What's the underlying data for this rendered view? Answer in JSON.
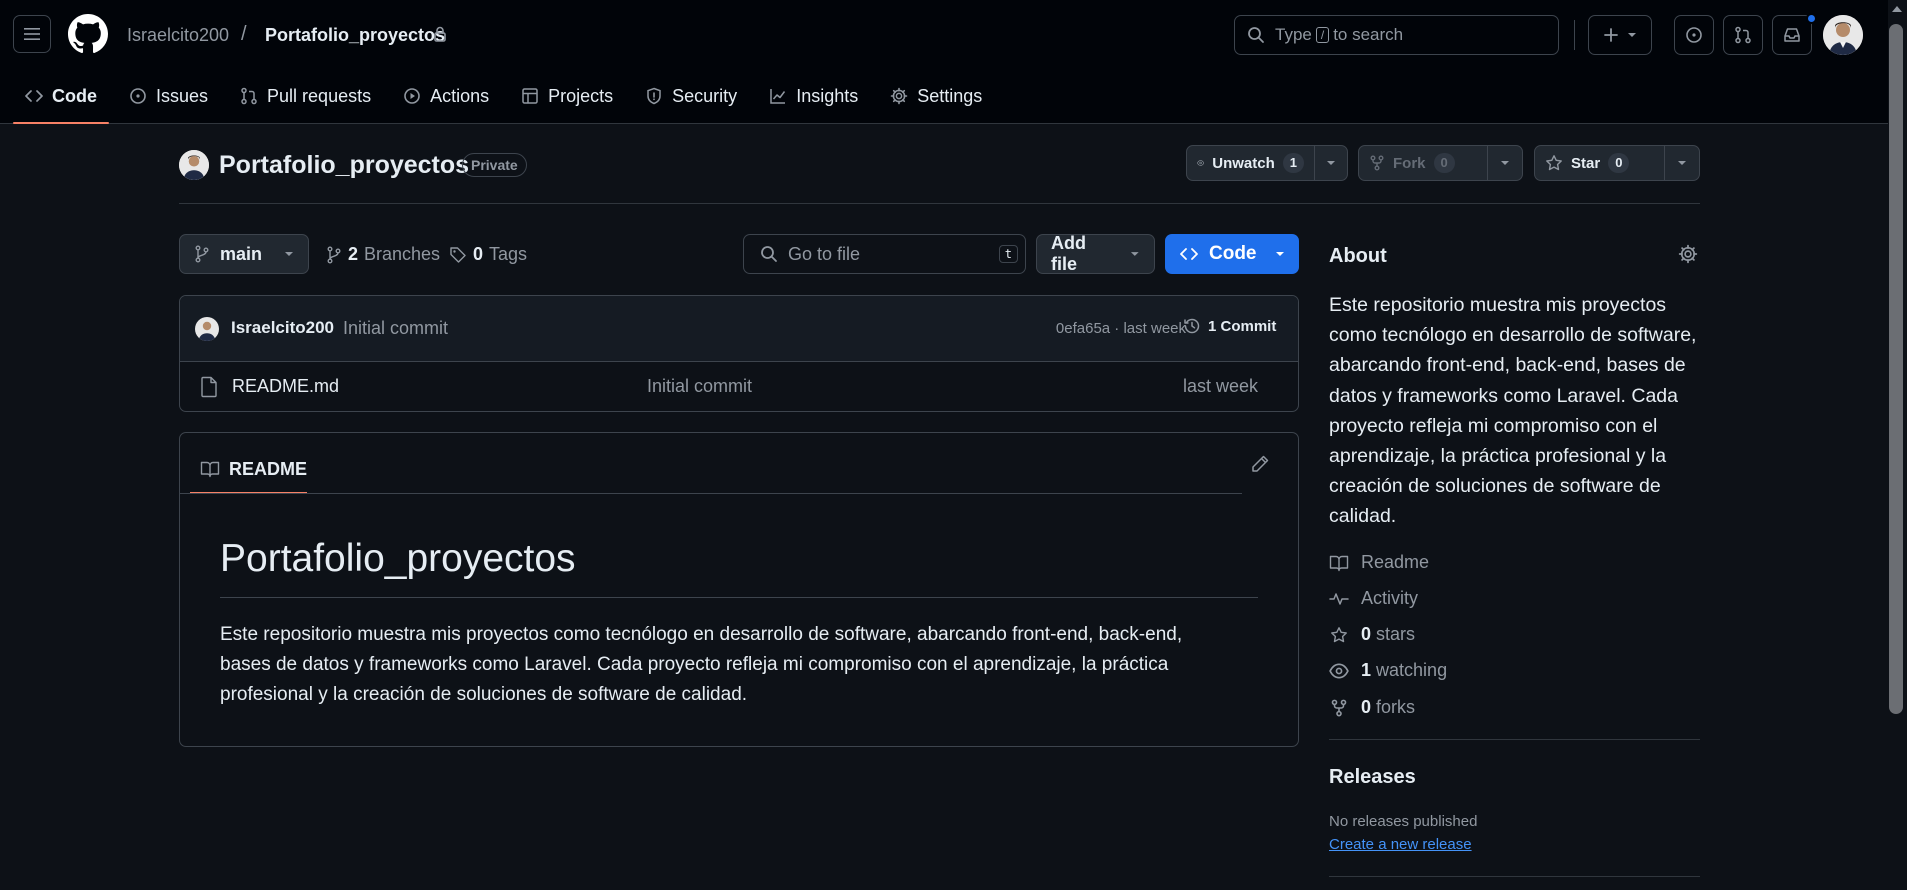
{
  "header": {
    "owner": "Israelcito200",
    "separator": "/",
    "repo_name": "Portafolio_proyectos",
    "search_prefix": "Type",
    "search_key": "/",
    "search_suffix": "to search"
  },
  "nav": {
    "code": "Code",
    "issues": "Issues",
    "pull_requests": "Pull requests",
    "actions": "Actions",
    "projects": "Projects",
    "security": "Security",
    "insights": "Insights",
    "settings": "Settings"
  },
  "repo": {
    "title": "Portafolio_proyectos",
    "visibility": "Private",
    "unwatch_label": "Unwatch",
    "watch_count": "1",
    "fork_label": "Fork",
    "fork_count": "0",
    "star_label": "Star",
    "star_count": "0"
  },
  "toolbar": {
    "branch": "main",
    "branches_count": "2",
    "branches_label": "Branches",
    "tags_count": "0",
    "tags_label": "Tags",
    "goto_placeholder": "Go to file",
    "goto_key": "t",
    "add_file": "Add file",
    "code_button": "Code"
  },
  "commit": {
    "author": "Israelcito200",
    "message": "Initial commit",
    "sha_time": "0efa65a · last week",
    "count_label": "1 Commit"
  },
  "files": [
    {
      "name": "README.md",
      "message": "Initial commit",
      "time": "last week"
    }
  ],
  "readme": {
    "tab_label": "README",
    "heading": "Portafolio_proyectos",
    "body": "Este repositorio muestra mis proyectos como tecnólogo en desarrollo de software, abarcando front-end, back-end, bases de datos y frameworks como Laravel. Cada proyecto refleja mi compromiso con el aprendizaje, la práctica profesional y la creación de soluciones de software de calidad."
  },
  "about": {
    "heading": "About",
    "description": "Este repositorio muestra mis proyectos como tecnólogo en desarrollo de software, abarcando front-end, back-end, bases de datos y frameworks como Laravel. Cada proyecto refleja mi compromiso con el aprendizaje, la práctica profesional y la creación de soluciones de software de calidad.",
    "readme_link": "Readme",
    "activity_link": "Activity",
    "stars_count": "0",
    "stars_label": "stars",
    "watching_count": "1",
    "watching_label": "watching",
    "forks_count": "0",
    "forks_label": "forks"
  },
  "releases": {
    "heading": "Releases",
    "none_text": "No releases published",
    "create_link": "Create a new release"
  },
  "colors": {
    "background": "#0d1117",
    "header_bg": "#010409",
    "accent_blue": "#1f6feb",
    "active_tab_underline": "#f78166",
    "link": "#4493f8"
  }
}
